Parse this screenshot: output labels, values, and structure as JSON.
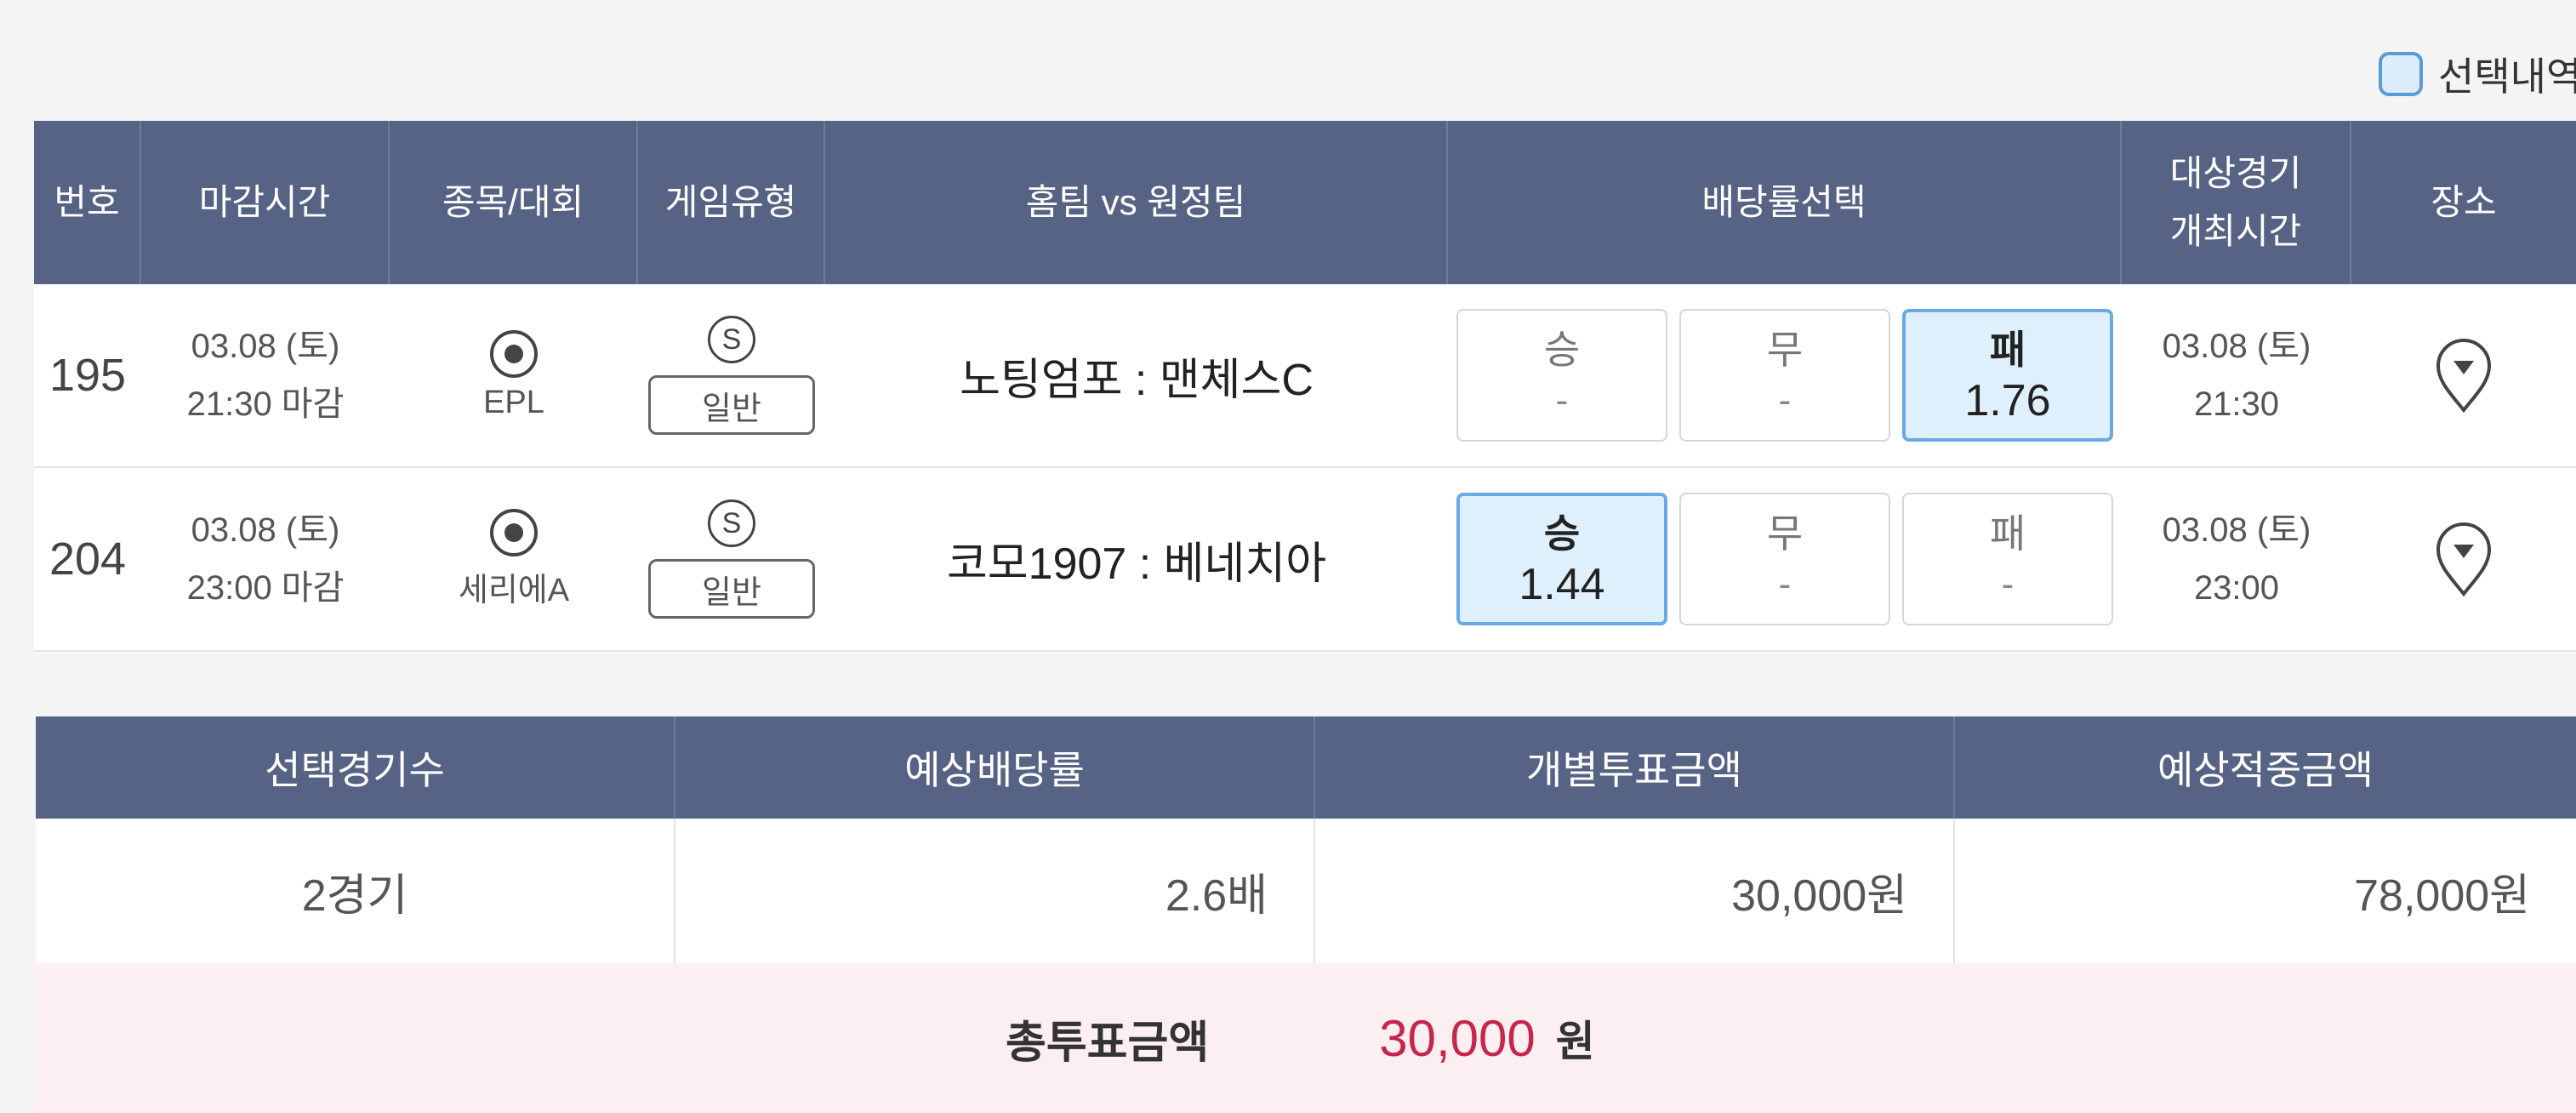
{
  "toggle": {
    "label": "선택내역"
  },
  "table": {
    "headers": {
      "no": "번호",
      "deadline": "마감시간",
      "sport": "종목/대회",
      "game_type": "게임유형",
      "teams": "홈팀 vs 원정팀",
      "odds": "배당률선택",
      "target_line1": "대상경기",
      "target_line2": "개최시간",
      "venue": "장소"
    },
    "rows": [
      {
        "no": "195",
        "deadline_date": "03.08 (토)",
        "deadline_time": "21:30 마감",
        "league": "EPL",
        "game_icon": "S",
        "game_type": "일반",
        "match": "노팅엄포 : 맨체스C",
        "odds": [
          {
            "label": "승",
            "value": "-",
            "selected": false
          },
          {
            "label": "무",
            "value": "-",
            "selected": false
          },
          {
            "label": "패",
            "value": "1.76",
            "selected": true
          }
        ],
        "event_date": "03.08 (토)",
        "event_time": "21:30"
      },
      {
        "no": "204",
        "deadline_date": "03.08 (토)",
        "deadline_time": "23:00 마감",
        "league": "세리에A",
        "game_icon": "S",
        "game_type": "일반",
        "match": "코모1907 : 베네치아",
        "odds": [
          {
            "label": "승",
            "value": "1.44",
            "selected": true
          },
          {
            "label": "무",
            "value": "-",
            "selected": false
          },
          {
            "label": "패",
            "value": "-",
            "selected": false
          }
        ],
        "event_date": "03.08 (토)",
        "event_time": "23:00"
      }
    ]
  },
  "summary": {
    "headers": [
      "선택경기수",
      "예상배당률",
      "개별투표금액",
      "예상적중금액"
    ],
    "values": [
      "2경기",
      "2.6배",
      "30,000원",
      "78,000원"
    ],
    "total_label": "총투표금액",
    "total_value": "30,000",
    "total_unit": "원"
  },
  "colors": {
    "header_bg": "#576385",
    "selected_odd_bg": "#dff0fd",
    "selected_odd_border": "#6aa9e3",
    "total_bg": "#fbeff1",
    "total_value": "#c8254b"
  },
  "icons": [
    "soccer-ball-icon",
    "s-circle-icon",
    "map-pin-icon"
  ]
}
